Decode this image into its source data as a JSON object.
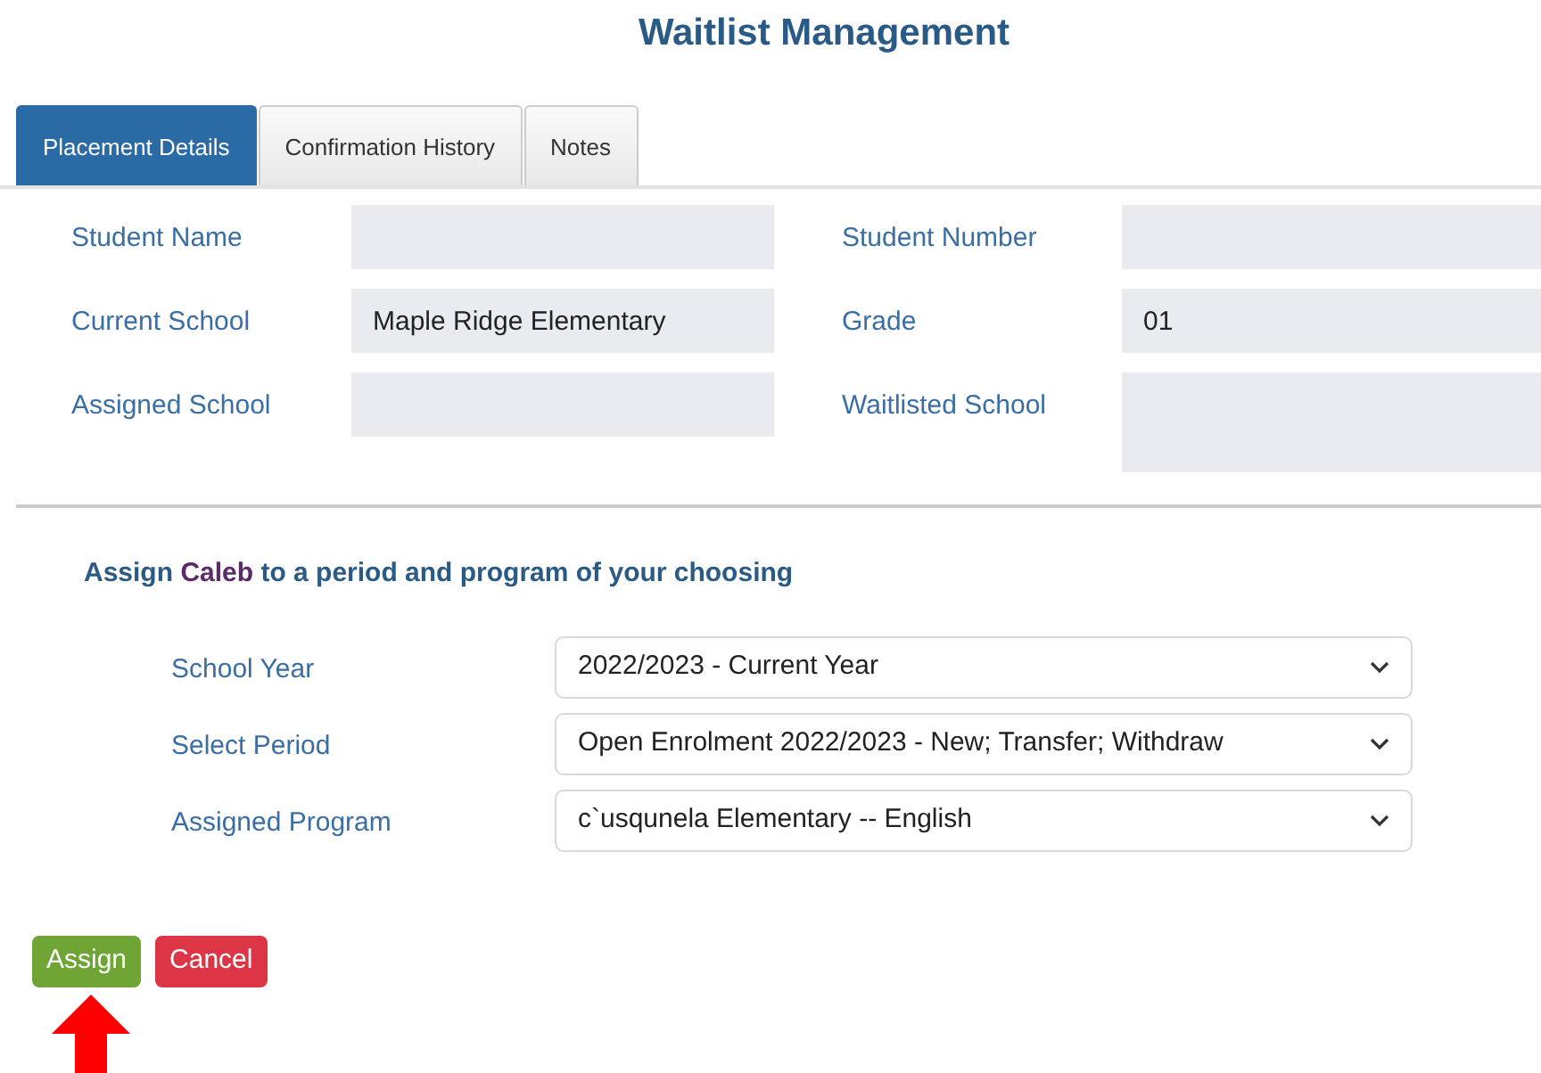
{
  "title": "Waitlist Management",
  "tabs": [
    {
      "label": "Placement Details",
      "selected": true
    },
    {
      "label": "Confirmation History",
      "selected": false
    },
    {
      "label": "Notes",
      "selected": false
    }
  ],
  "details": [
    {
      "label": "Student Name"
    },
    {
      "label": "Student Number"
    },
    {
      "label": "Current School",
      "value": "Maple Ridge Elementary"
    },
    {
      "label": "Grade",
      "value": "01"
    },
    {
      "label": "Assigned School"
    },
    {
      "label": "Waitlisted School",
      "tall": true
    }
  ],
  "instruction": {
    "before": "Assign ",
    "name": "Caleb",
    "after": " to a period and program of your choosing"
  },
  "selects": [
    {
      "label": "School Year",
      "value": "2022/2023 - Current Year"
    },
    {
      "label": "Select Period",
      "value": "Open Enrolment 2022/2023 - New; Transfer; Withdraw"
    },
    {
      "label": "Assigned Program",
      "value": "c`usqunela Elementary -- English"
    }
  ],
  "buttons": [
    {
      "label": "Assign",
      "kind": "success"
    },
    {
      "label": "Cancel",
      "kind": "danger"
    }
  ]
}
